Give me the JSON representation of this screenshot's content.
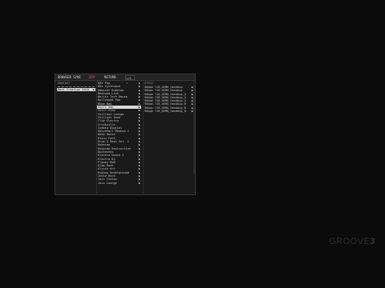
{
  "topbar": {
    "tabs": [
      {
        "label": "BROWSER SYNC",
        "active": false
      },
      {
        "label": "BPM",
        "active": true
      },
      {
        "label": "RETURN",
        "active": false
      }
    ],
    "dropdown": "1/8 ▾"
  },
  "columns": {
    "categories": {
      "header": "KONTAKT",
      "items": [
        {
          "label": "Beat Creation 2018",
          "arrow": "▶",
          "selected": true
        }
      ]
    },
    "kits": {
      "items": [
        {
          "label": "80s Pop",
          "arrow": "▶"
        },
        {
          "label": "80s Synthwave",
          "arrow": "▶"
        },
        {
          "label": "Ambient Dubstep",
          "arrow": "▶"
        },
        {
          "label": "Bedroom Live",
          "arrow": "▶"
        },
        {
          "label": "Berlin Tech House",
          "arrow": "▶"
        },
        {
          "label": "Bollywood Pop",
          "arrow": "▶"
        },
        {
          "label": "Boom Bap",
          "arrow": "▶"
        },
        {
          "label": "Chill Hop",
          "arrow": "▶",
          "selected": true
        },
        {
          "label": "Chill Step",
          "arrow": "▶"
        },
        {
          "label": "Chillout Lounge",
          "arrow": "▶"
        },
        {
          "label": "Chillout Zone",
          "arrow": "▶"
        },
        {
          "label": "Club Electro",
          "arrow": "▶"
        },
        {
          "label": "Crunkville",
          "arrow": "▶"
        },
        {
          "label": "Cumbia Digital",
          "arrow": "▶"
        },
        {
          "label": "Dancehall Mashup 2",
          "arrow": "▶"
        },
        {
          "label": "Deep House",
          "arrow": "▶"
        },
        {
          "label": "Disco Funk",
          "arrow": "▶"
        },
        {
          "label": "Drum & Bass Vol. 1",
          "arrow": "▶"
        },
        {
          "label": "Dubstep",
          "arrow": "▶"
        },
        {
          "label": "Dubstep Destruction",
          "arrow": "▶"
        },
        {
          "label": "Dubtechno",
          "arrow": "▶"
        },
        {
          "label": "Electro House 2",
          "arrow": "▶"
        },
        {
          "label": "Electro DJ",
          "arrow": "▶"
        },
        {
          "label": "Flowey R&B",
          "arrow": "▶"
        },
        {
          "label": "Glam Rock",
          "arrow": "▶"
        },
        {
          "label": "Glitch Art",
          "arrow": "▶"
        },
        {
          "label": "Hiphop Underground",
          "arrow": "▶"
        },
        {
          "label": "Indie Rock",
          "arrow": "▶"
        },
        {
          "label": "Jazz Fusion",
          "arrow": "▶"
        },
        {
          "label": "Jazz Lounge",
          "arrow": "▶"
        }
      ]
    },
    "patterns": {
      "header": "STYLE",
      "items": [
        {
          "label": "90bpm TiB_DEMO_Handbug",
          "arrow": "▶"
        },
        {
          "label": "90bpm TiB_DEMO_Handbug",
          "arrow": "▶"
        },
        {
          "label": "90bpm TiB_DEMO_Handbug_A",
          "arrow": "▶"
        },
        {
          "label": "90bpm TiB_DEMO_Handbug_A",
          "arrow": "▶"
        },
        {
          "label": "90bpm TiB_DEMO_Handbug_A",
          "arrow": "▶"
        },
        {
          "label": "90bpm TiB_DEMO_Handbug_B",
          "arrow": "▶"
        },
        {
          "label": "90bpm TiB_DEMO_Handbug_B",
          "arrow": "▶"
        },
        {
          "label": "90bpm TiB_DEMO_Handbug_B",
          "arrow": "▶"
        }
      ]
    }
  },
  "watermark": {
    "word": "GROOVE",
    "num": "3"
  }
}
